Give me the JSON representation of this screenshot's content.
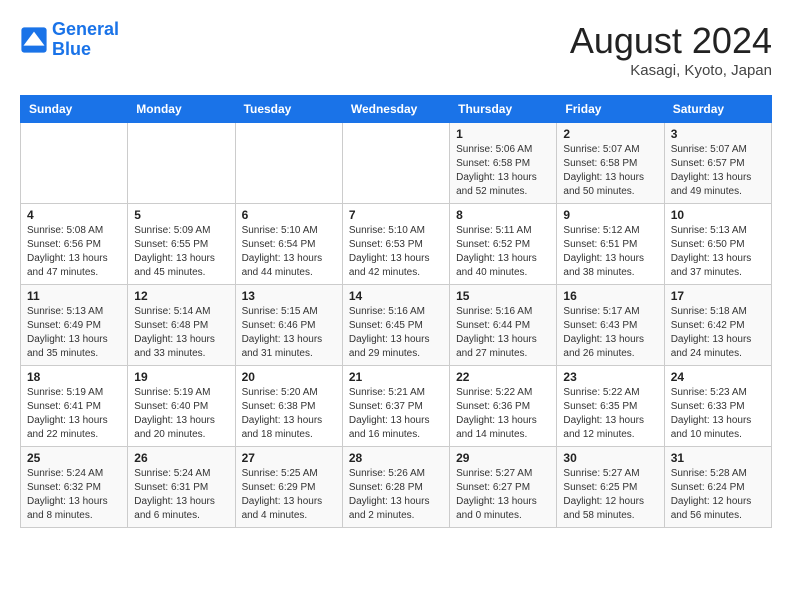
{
  "header": {
    "logo_line1": "General",
    "logo_line2": "Blue",
    "month": "August 2024",
    "location": "Kasagi, Kyoto, Japan"
  },
  "weekdays": [
    "Sunday",
    "Monday",
    "Tuesday",
    "Wednesday",
    "Thursday",
    "Friday",
    "Saturday"
  ],
  "weeks": [
    [
      {
        "day": "",
        "info": ""
      },
      {
        "day": "",
        "info": ""
      },
      {
        "day": "",
        "info": ""
      },
      {
        "day": "",
        "info": ""
      },
      {
        "day": "1",
        "info": "Sunrise: 5:06 AM\nSunset: 6:58 PM\nDaylight: 13 hours\nand 52 minutes."
      },
      {
        "day": "2",
        "info": "Sunrise: 5:07 AM\nSunset: 6:58 PM\nDaylight: 13 hours\nand 50 minutes."
      },
      {
        "day": "3",
        "info": "Sunrise: 5:07 AM\nSunset: 6:57 PM\nDaylight: 13 hours\nand 49 minutes."
      }
    ],
    [
      {
        "day": "4",
        "info": "Sunrise: 5:08 AM\nSunset: 6:56 PM\nDaylight: 13 hours\nand 47 minutes."
      },
      {
        "day": "5",
        "info": "Sunrise: 5:09 AM\nSunset: 6:55 PM\nDaylight: 13 hours\nand 45 minutes."
      },
      {
        "day": "6",
        "info": "Sunrise: 5:10 AM\nSunset: 6:54 PM\nDaylight: 13 hours\nand 44 minutes."
      },
      {
        "day": "7",
        "info": "Sunrise: 5:10 AM\nSunset: 6:53 PM\nDaylight: 13 hours\nand 42 minutes."
      },
      {
        "day": "8",
        "info": "Sunrise: 5:11 AM\nSunset: 6:52 PM\nDaylight: 13 hours\nand 40 minutes."
      },
      {
        "day": "9",
        "info": "Sunrise: 5:12 AM\nSunset: 6:51 PM\nDaylight: 13 hours\nand 38 minutes."
      },
      {
        "day": "10",
        "info": "Sunrise: 5:13 AM\nSunset: 6:50 PM\nDaylight: 13 hours\nand 37 minutes."
      }
    ],
    [
      {
        "day": "11",
        "info": "Sunrise: 5:13 AM\nSunset: 6:49 PM\nDaylight: 13 hours\nand 35 minutes."
      },
      {
        "day": "12",
        "info": "Sunrise: 5:14 AM\nSunset: 6:48 PM\nDaylight: 13 hours\nand 33 minutes."
      },
      {
        "day": "13",
        "info": "Sunrise: 5:15 AM\nSunset: 6:46 PM\nDaylight: 13 hours\nand 31 minutes."
      },
      {
        "day": "14",
        "info": "Sunrise: 5:16 AM\nSunset: 6:45 PM\nDaylight: 13 hours\nand 29 minutes."
      },
      {
        "day": "15",
        "info": "Sunrise: 5:16 AM\nSunset: 6:44 PM\nDaylight: 13 hours\nand 27 minutes."
      },
      {
        "day": "16",
        "info": "Sunrise: 5:17 AM\nSunset: 6:43 PM\nDaylight: 13 hours\nand 26 minutes."
      },
      {
        "day": "17",
        "info": "Sunrise: 5:18 AM\nSunset: 6:42 PM\nDaylight: 13 hours\nand 24 minutes."
      }
    ],
    [
      {
        "day": "18",
        "info": "Sunrise: 5:19 AM\nSunset: 6:41 PM\nDaylight: 13 hours\nand 22 minutes."
      },
      {
        "day": "19",
        "info": "Sunrise: 5:19 AM\nSunset: 6:40 PM\nDaylight: 13 hours\nand 20 minutes."
      },
      {
        "day": "20",
        "info": "Sunrise: 5:20 AM\nSunset: 6:38 PM\nDaylight: 13 hours\nand 18 minutes."
      },
      {
        "day": "21",
        "info": "Sunrise: 5:21 AM\nSunset: 6:37 PM\nDaylight: 13 hours\nand 16 minutes."
      },
      {
        "day": "22",
        "info": "Sunrise: 5:22 AM\nSunset: 6:36 PM\nDaylight: 13 hours\nand 14 minutes."
      },
      {
        "day": "23",
        "info": "Sunrise: 5:22 AM\nSunset: 6:35 PM\nDaylight: 13 hours\nand 12 minutes."
      },
      {
        "day": "24",
        "info": "Sunrise: 5:23 AM\nSunset: 6:33 PM\nDaylight: 13 hours\nand 10 minutes."
      }
    ],
    [
      {
        "day": "25",
        "info": "Sunrise: 5:24 AM\nSunset: 6:32 PM\nDaylight: 13 hours\nand 8 minutes."
      },
      {
        "day": "26",
        "info": "Sunrise: 5:24 AM\nSunset: 6:31 PM\nDaylight: 13 hours\nand 6 minutes."
      },
      {
        "day": "27",
        "info": "Sunrise: 5:25 AM\nSunset: 6:29 PM\nDaylight: 13 hours\nand 4 minutes."
      },
      {
        "day": "28",
        "info": "Sunrise: 5:26 AM\nSunset: 6:28 PM\nDaylight: 13 hours\nand 2 minutes."
      },
      {
        "day": "29",
        "info": "Sunrise: 5:27 AM\nSunset: 6:27 PM\nDaylight: 13 hours\nand 0 minutes."
      },
      {
        "day": "30",
        "info": "Sunrise: 5:27 AM\nSunset: 6:25 PM\nDaylight: 12 hours\nand 58 minutes."
      },
      {
        "day": "31",
        "info": "Sunrise: 5:28 AM\nSunset: 6:24 PM\nDaylight: 12 hours\nand 56 minutes."
      }
    ]
  ]
}
